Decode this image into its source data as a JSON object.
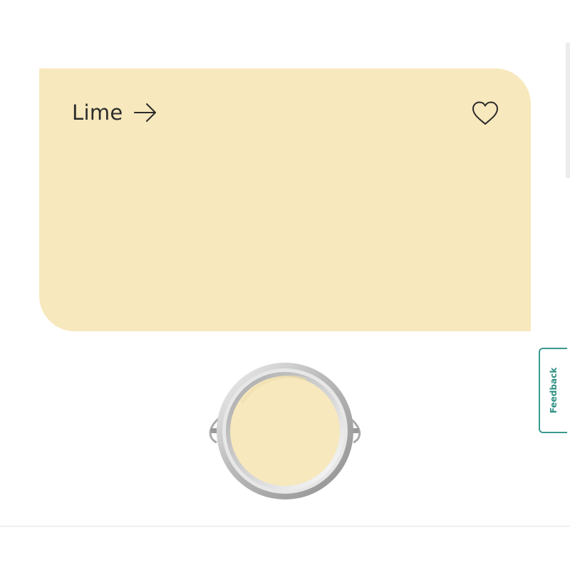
{
  "swatch": {
    "name": "Lime",
    "color": "#f7e8bd",
    "arrow_icon": "arrow-right-icon",
    "favorite_icon": "heart-outline-icon"
  },
  "feedback": {
    "label": "Feedback",
    "accent_color": "#3a9a8e"
  },
  "paint_tin": {
    "icon": "paint-tin-icon",
    "paint_color": "#f7e8bd"
  }
}
